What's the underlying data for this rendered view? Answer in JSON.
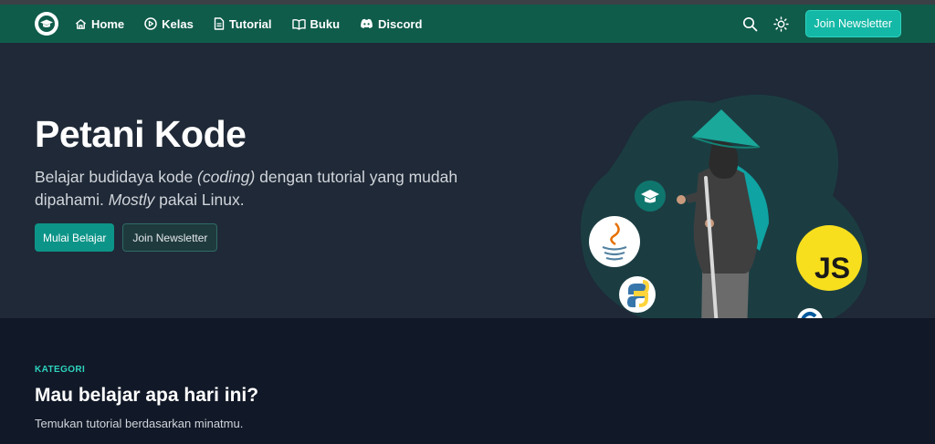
{
  "nav": {
    "items": [
      {
        "label": "Home",
        "icon": "home-icon"
      },
      {
        "label": "Kelas",
        "icon": "play-circle-icon"
      },
      {
        "label": "Tutorial",
        "icon": "document-icon"
      },
      {
        "label": "Buku",
        "icon": "book-icon"
      },
      {
        "label": "Discord",
        "icon": "discord-icon"
      }
    ],
    "newsletter_label": "Join Newsletter"
  },
  "hero": {
    "title": "Petani Kode",
    "desc_part1": "Belajar budidaya kode ",
    "desc_italic1": "(coding)",
    "desc_part2": " dengan tutorial yang mudah dipahami. ",
    "desc_italic2": "Mostly",
    "desc_part3": " pakai Linux.",
    "primary_button": "Mulai Belajar",
    "secondary_button": "Join Newsletter"
  },
  "illustration": {
    "js_badge": "JS"
  },
  "category": {
    "label": "KATEGORI",
    "title": "Mau belajar apa hari ini?",
    "subtitle": "Temukan tutorial berdasarkan minatmu."
  },
  "colors": {
    "navbar": "#0f5c4b",
    "accent": "#14b8a6",
    "hero_bg": "#1f2937",
    "page_bg": "#111827"
  }
}
